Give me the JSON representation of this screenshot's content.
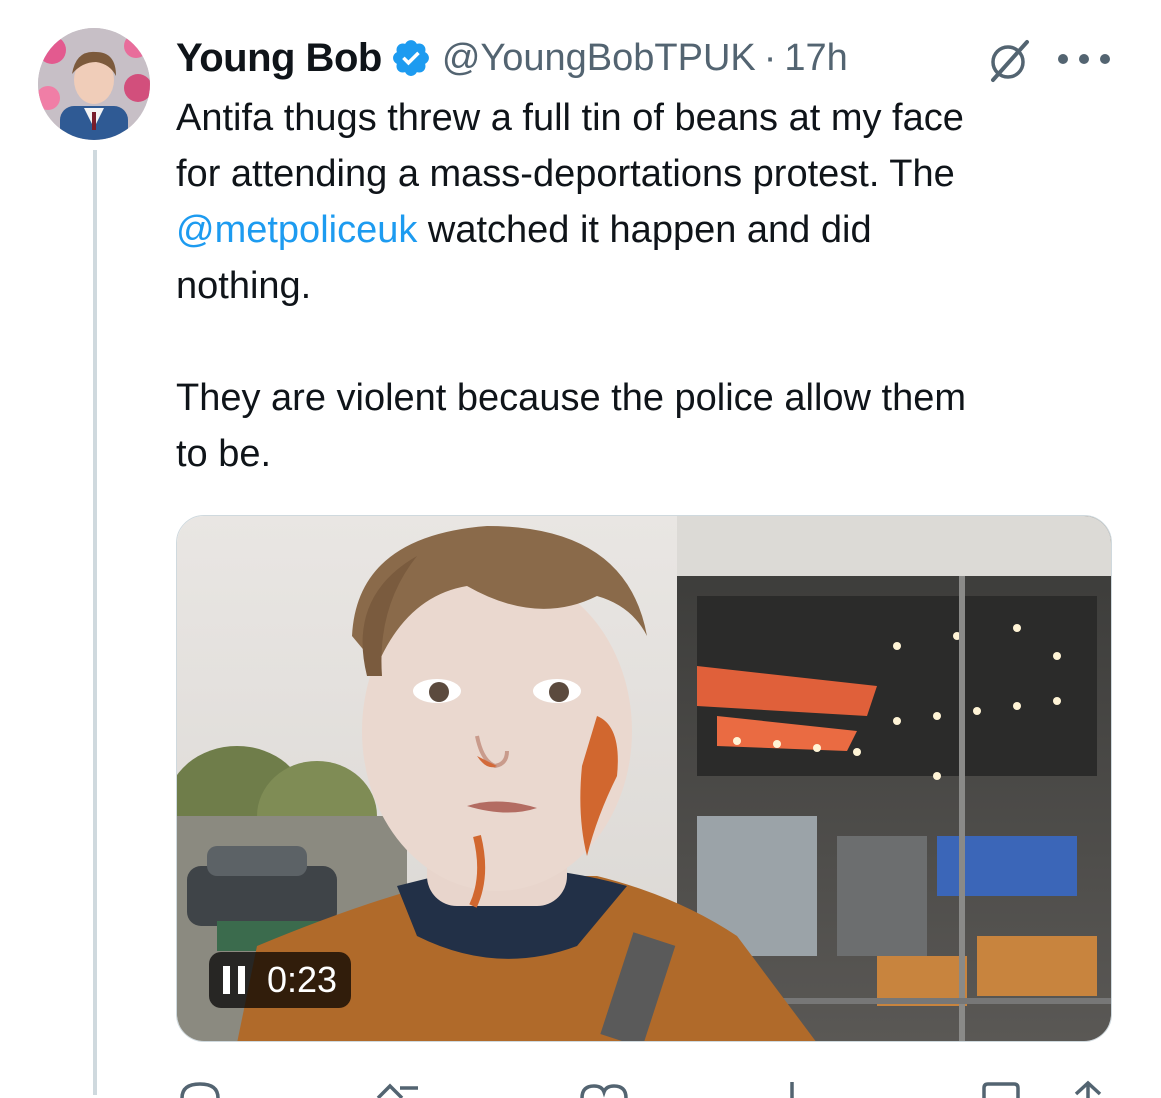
{
  "tweet": {
    "display_name": "Young Bob",
    "handle": "@YoungBobTPUK",
    "separator": "·",
    "time": "17h",
    "text": {
      "line1": "Antifa thugs threw a full tin of beans at my face",
      "line2": "for attending a mass-deportations protest. The",
      "mention": "@metpoliceuk",
      "line3_rest": " watched it happen and did",
      "line4": "nothing.",
      "line5": "They are violent because the police allow them",
      "line6": "to be."
    }
  },
  "video": {
    "elapsed": "0:23",
    "state": "playing"
  },
  "icons": {
    "verified": "verified-badge-icon",
    "grok": "grok-icon",
    "more": "more-icon",
    "pause": "pause-icon",
    "reply": "reply-icon",
    "repost": "repost-icon",
    "like": "like-icon",
    "views": "views-icon",
    "bookmark": "bookmark-icon",
    "share": "share-icon"
  },
  "colors": {
    "link": "#1d9bf0",
    "verified": "#1d9bf0",
    "secondary_text": "#536471",
    "primary_text": "#0f1419"
  }
}
